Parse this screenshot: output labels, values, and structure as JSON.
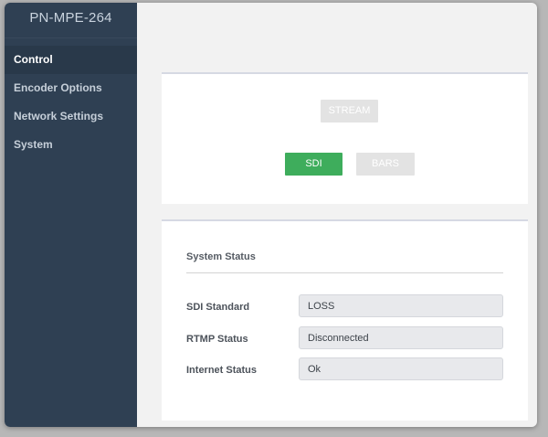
{
  "brand": {
    "title": "PN-MPE-264"
  },
  "sidebar": {
    "items": [
      {
        "label": "Control",
        "active": true
      },
      {
        "label": "Encoder Options",
        "active": false
      },
      {
        "label": "Network Settings",
        "active": false
      },
      {
        "label": "System",
        "active": false
      }
    ]
  },
  "controls": {
    "stream_label": "STREAM",
    "sdi_label": "SDI",
    "bars_label": "BARS",
    "sdi_selected": true
  },
  "status": {
    "title": "System Status",
    "rows": [
      {
        "label": "SDI Standard",
        "value": "LOSS"
      },
      {
        "label": "RTMP Status",
        "value": "Disconnected"
      },
      {
        "label": "Internet Status",
        "value": "Ok"
      }
    ]
  },
  "colors": {
    "sidebar_bg": "#2f4053",
    "sidebar_active_bg": "#29394a",
    "accent_green": "#3ead5c",
    "disabled_button": "#e3e3e3"
  }
}
